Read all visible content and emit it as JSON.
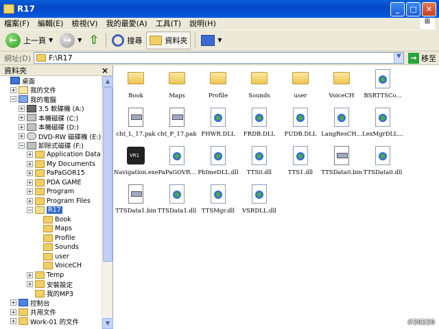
{
  "window": {
    "title": "R17",
    "min": "_",
    "max": "□",
    "close": "✕"
  },
  "menu": [
    "檔案(F)",
    "編輯(E)",
    "檢視(V)",
    "我的最愛(A)",
    "工具(T)",
    "說明(H)"
  ],
  "toolbar": {
    "back": "上一頁",
    "search": "搜尋",
    "folders": "資料夾"
  },
  "address": {
    "label": "網址(D)",
    "value": "F:\\R17",
    "go": "移至"
  },
  "tree": {
    "header": "資料夾",
    "rows": [
      {
        "label": "桌面",
        "indent": 0,
        "exp": "",
        "icon": "desktop"
      },
      {
        "label": "我的文件",
        "indent": 1,
        "exp": "+",
        "icon": "docs"
      },
      {
        "label": "我的電腦",
        "indent": 1,
        "exp": "−",
        "icon": "pc"
      },
      {
        "label": "3.5 軟碟機 (A:)",
        "indent": 2,
        "exp": "+",
        "icon": "floppy"
      },
      {
        "label": "本機磁碟 (C:)",
        "indent": 2,
        "exp": "+",
        "icon": "drive"
      },
      {
        "label": "本機磁碟 (D:)",
        "indent": 2,
        "exp": "+",
        "icon": "drive"
      },
      {
        "label": "DVD-RW 磁碟機 (E:)",
        "indent": 2,
        "exp": "+",
        "icon": "cdrom"
      },
      {
        "label": "卸除式磁碟 (F:)",
        "indent": 2,
        "exp": "−",
        "icon": "drive"
      },
      {
        "label": "Application Data",
        "indent": 3,
        "exp": "+",
        "icon": "folder"
      },
      {
        "label": "My Documents",
        "indent": 3,
        "exp": "+",
        "icon": "folder"
      },
      {
        "label": "PaPaGOR15",
        "indent": 3,
        "exp": "+",
        "icon": "folder"
      },
      {
        "label": "PDA GAME",
        "indent": 3,
        "exp": "+",
        "icon": "folder"
      },
      {
        "label": "Program",
        "indent": 3,
        "exp": "+",
        "icon": "folder"
      },
      {
        "label": "Program Files",
        "indent": 3,
        "exp": "+",
        "icon": "folder"
      },
      {
        "label": "R17",
        "indent": 3,
        "exp": "−",
        "icon": "folder-open",
        "selected": true
      },
      {
        "label": "Book",
        "indent": 4,
        "exp": "",
        "icon": "folder"
      },
      {
        "label": "Maps",
        "indent": 4,
        "exp": "",
        "icon": "folder"
      },
      {
        "label": "Profile",
        "indent": 4,
        "exp": "",
        "icon": "folder"
      },
      {
        "label": "Sounds",
        "indent": 4,
        "exp": "",
        "icon": "folder"
      },
      {
        "label": "user",
        "indent": 4,
        "exp": "",
        "icon": "folder"
      },
      {
        "label": "VoiceCH",
        "indent": 4,
        "exp": "",
        "icon": "folder"
      },
      {
        "label": "Temp",
        "indent": 3,
        "exp": "+",
        "icon": "folder"
      },
      {
        "label": "安裝設定",
        "indent": 3,
        "exp": "+",
        "icon": "folder"
      },
      {
        "label": "我的MP3",
        "indent": 3,
        "exp": "",
        "icon": "folder"
      },
      {
        "label": "控制台",
        "indent": 1,
        "exp": "+",
        "icon": "control"
      },
      {
        "label": "共用文件",
        "indent": 1,
        "exp": "+",
        "icon": "folder"
      },
      {
        "label": "Work-01 的文件",
        "indent": 1,
        "exp": "+",
        "icon": "folder"
      }
    ]
  },
  "files": [
    {
      "label": "Book",
      "type": "folder"
    },
    {
      "label": "Maps",
      "type": "folder"
    },
    {
      "label": "Profile",
      "type": "folder"
    },
    {
      "label": "Sounds",
      "type": "folder"
    },
    {
      "label": "user",
      "type": "folder"
    },
    {
      "label": "VoiceCH",
      "type": "folder"
    },
    {
      "label": "BSRTTSCo...",
      "type": "dll"
    },
    {
      "label": "cht_L_17.pak",
      "type": "file"
    },
    {
      "label": "cht_P_17.pak",
      "type": "file"
    },
    {
      "label": "FHWR.DLL",
      "type": "dll"
    },
    {
      "label": "FRDB.DLL",
      "type": "dll"
    },
    {
      "label": "FUDB.DLL",
      "type": "dll"
    },
    {
      "label": "LangResCH...",
      "type": "dll"
    },
    {
      "label": "LexMgrDLL...",
      "type": "dll"
    },
    {
      "label": "Navigation.exe",
      "type": "exe"
    },
    {
      "label": "PaPaGOVR...",
      "type": "dll"
    },
    {
      "label": "PhImeDLL.dll",
      "type": "dll"
    },
    {
      "label": "TTS0.dll",
      "type": "dll"
    },
    {
      "label": "TTS1.dll",
      "type": "dll"
    },
    {
      "label": "TTSData0.bin",
      "type": "file"
    },
    {
      "label": "TTSData0.dll",
      "type": "dll"
    },
    {
      "label": "TTSData1.bin",
      "type": "file"
    },
    {
      "label": "TTSData1.dll",
      "type": "dll"
    },
    {
      "label": "TTSMgr.dll",
      "type": "dll"
    },
    {
      "label": "VSRDLL.dll",
      "type": "dll"
    }
  ],
  "watermark": "#26226",
  "exe_badge": "VR1"
}
